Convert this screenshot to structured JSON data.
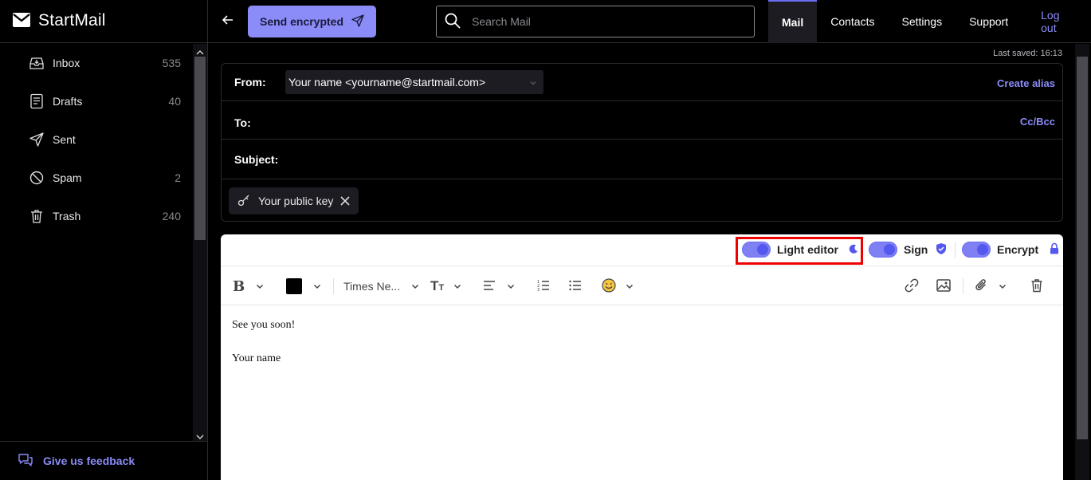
{
  "app": {
    "name": "StartMail"
  },
  "header": {
    "send_label": "Send encrypted",
    "search_placeholder": "Search Mail",
    "nav": [
      {
        "label": "Mail",
        "active": true
      },
      {
        "label": "Contacts"
      },
      {
        "label": "Settings"
      },
      {
        "label": "Support"
      },
      {
        "label": "Log out"
      }
    ]
  },
  "sidebar": {
    "folders": [
      {
        "name": "Inbox",
        "count": "535",
        "icon": "inbox-icon"
      },
      {
        "name": "Drafts",
        "count": "40",
        "icon": "drafts-icon"
      },
      {
        "name": "Sent",
        "count": "",
        "icon": "send-icon"
      },
      {
        "name": "Spam",
        "count": "2",
        "icon": "spam-icon"
      },
      {
        "name": "Trash",
        "count": "240",
        "icon": "trash-icon"
      }
    ],
    "feedback_label": "Give us feedback"
  },
  "compose": {
    "last_saved": "Last saved: 16:13",
    "from_label": "From:",
    "from_value": "Your name <yourname@startmail.com>",
    "create_alias": "Create alias",
    "to_label": "To:",
    "cc_bcc": "Cc/Bcc",
    "subject_label": "Subject:",
    "public_key_chip": "Your public key"
  },
  "editor": {
    "toggles": {
      "light_editor": "Light editor",
      "sign": "Sign",
      "encrypt": "Encrypt"
    },
    "font_family": "Times Ne...",
    "text_color": "#000000",
    "body_lines": [
      "See you soon!",
      "Your name"
    ]
  },
  "colors": {
    "accent": "#8b8cf7",
    "highlight": "#ee0000"
  }
}
